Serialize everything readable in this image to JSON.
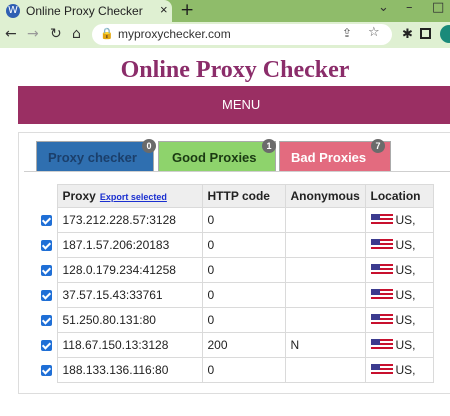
{
  "browser": {
    "tab_title": "Online Proxy Checker",
    "tab_close": "×",
    "new_tab": "+",
    "url": "myproxychecker.com",
    "win_min": "–",
    "win_chevron": "⌄",
    "win_max": "□"
  },
  "site": {
    "title": "Online Proxy Checker",
    "menu_label": "MENU"
  },
  "tabs": [
    {
      "label": "Proxy checker",
      "count": "0",
      "color": "#2f6fb0",
      "text_color": "#1b3f6b"
    },
    {
      "label": "Good Proxies",
      "count": "1",
      "color": "#8ed36c",
      "text_color": "#1a3a12"
    },
    {
      "label": "Bad Proxies",
      "count": "7",
      "color": "#e36b7f",
      "text_color": "#ffffff"
    }
  ],
  "table": {
    "headers": {
      "proxy": "Proxy",
      "export_link": "Export selected",
      "http_code": "HTTP code",
      "anonymous": "Anonymous",
      "location": "Location"
    },
    "rows": [
      {
        "proxy": "173.212.228.57:3128",
        "http_code": "0",
        "anonymous": "",
        "location": "US,"
      },
      {
        "proxy": "187.1.57.206:20183",
        "http_code": "0",
        "anonymous": "",
        "location": "US,"
      },
      {
        "proxy": "128.0.179.234:41258",
        "http_code": "0",
        "anonymous": "",
        "location": "US,"
      },
      {
        "proxy": "37.57.15.43:33761",
        "http_code": "0",
        "anonymous": "",
        "location": "US,"
      },
      {
        "proxy": "51.250.80.131:80",
        "http_code": "0",
        "anonymous": "",
        "location": "US,"
      },
      {
        "proxy": "118.67.150.13:3128",
        "http_code": "200",
        "anonymous": "N",
        "location": "US,"
      },
      {
        "proxy": "188.133.136.116:80",
        "http_code": "0",
        "anonymous": "",
        "location": "US,"
      }
    ]
  },
  "colors": {
    "title": "#8b2d6a",
    "menu_bar": "#9a2f63",
    "browser_chrome": "#dff0d2",
    "checkbox": "#1f6fd6"
  }
}
